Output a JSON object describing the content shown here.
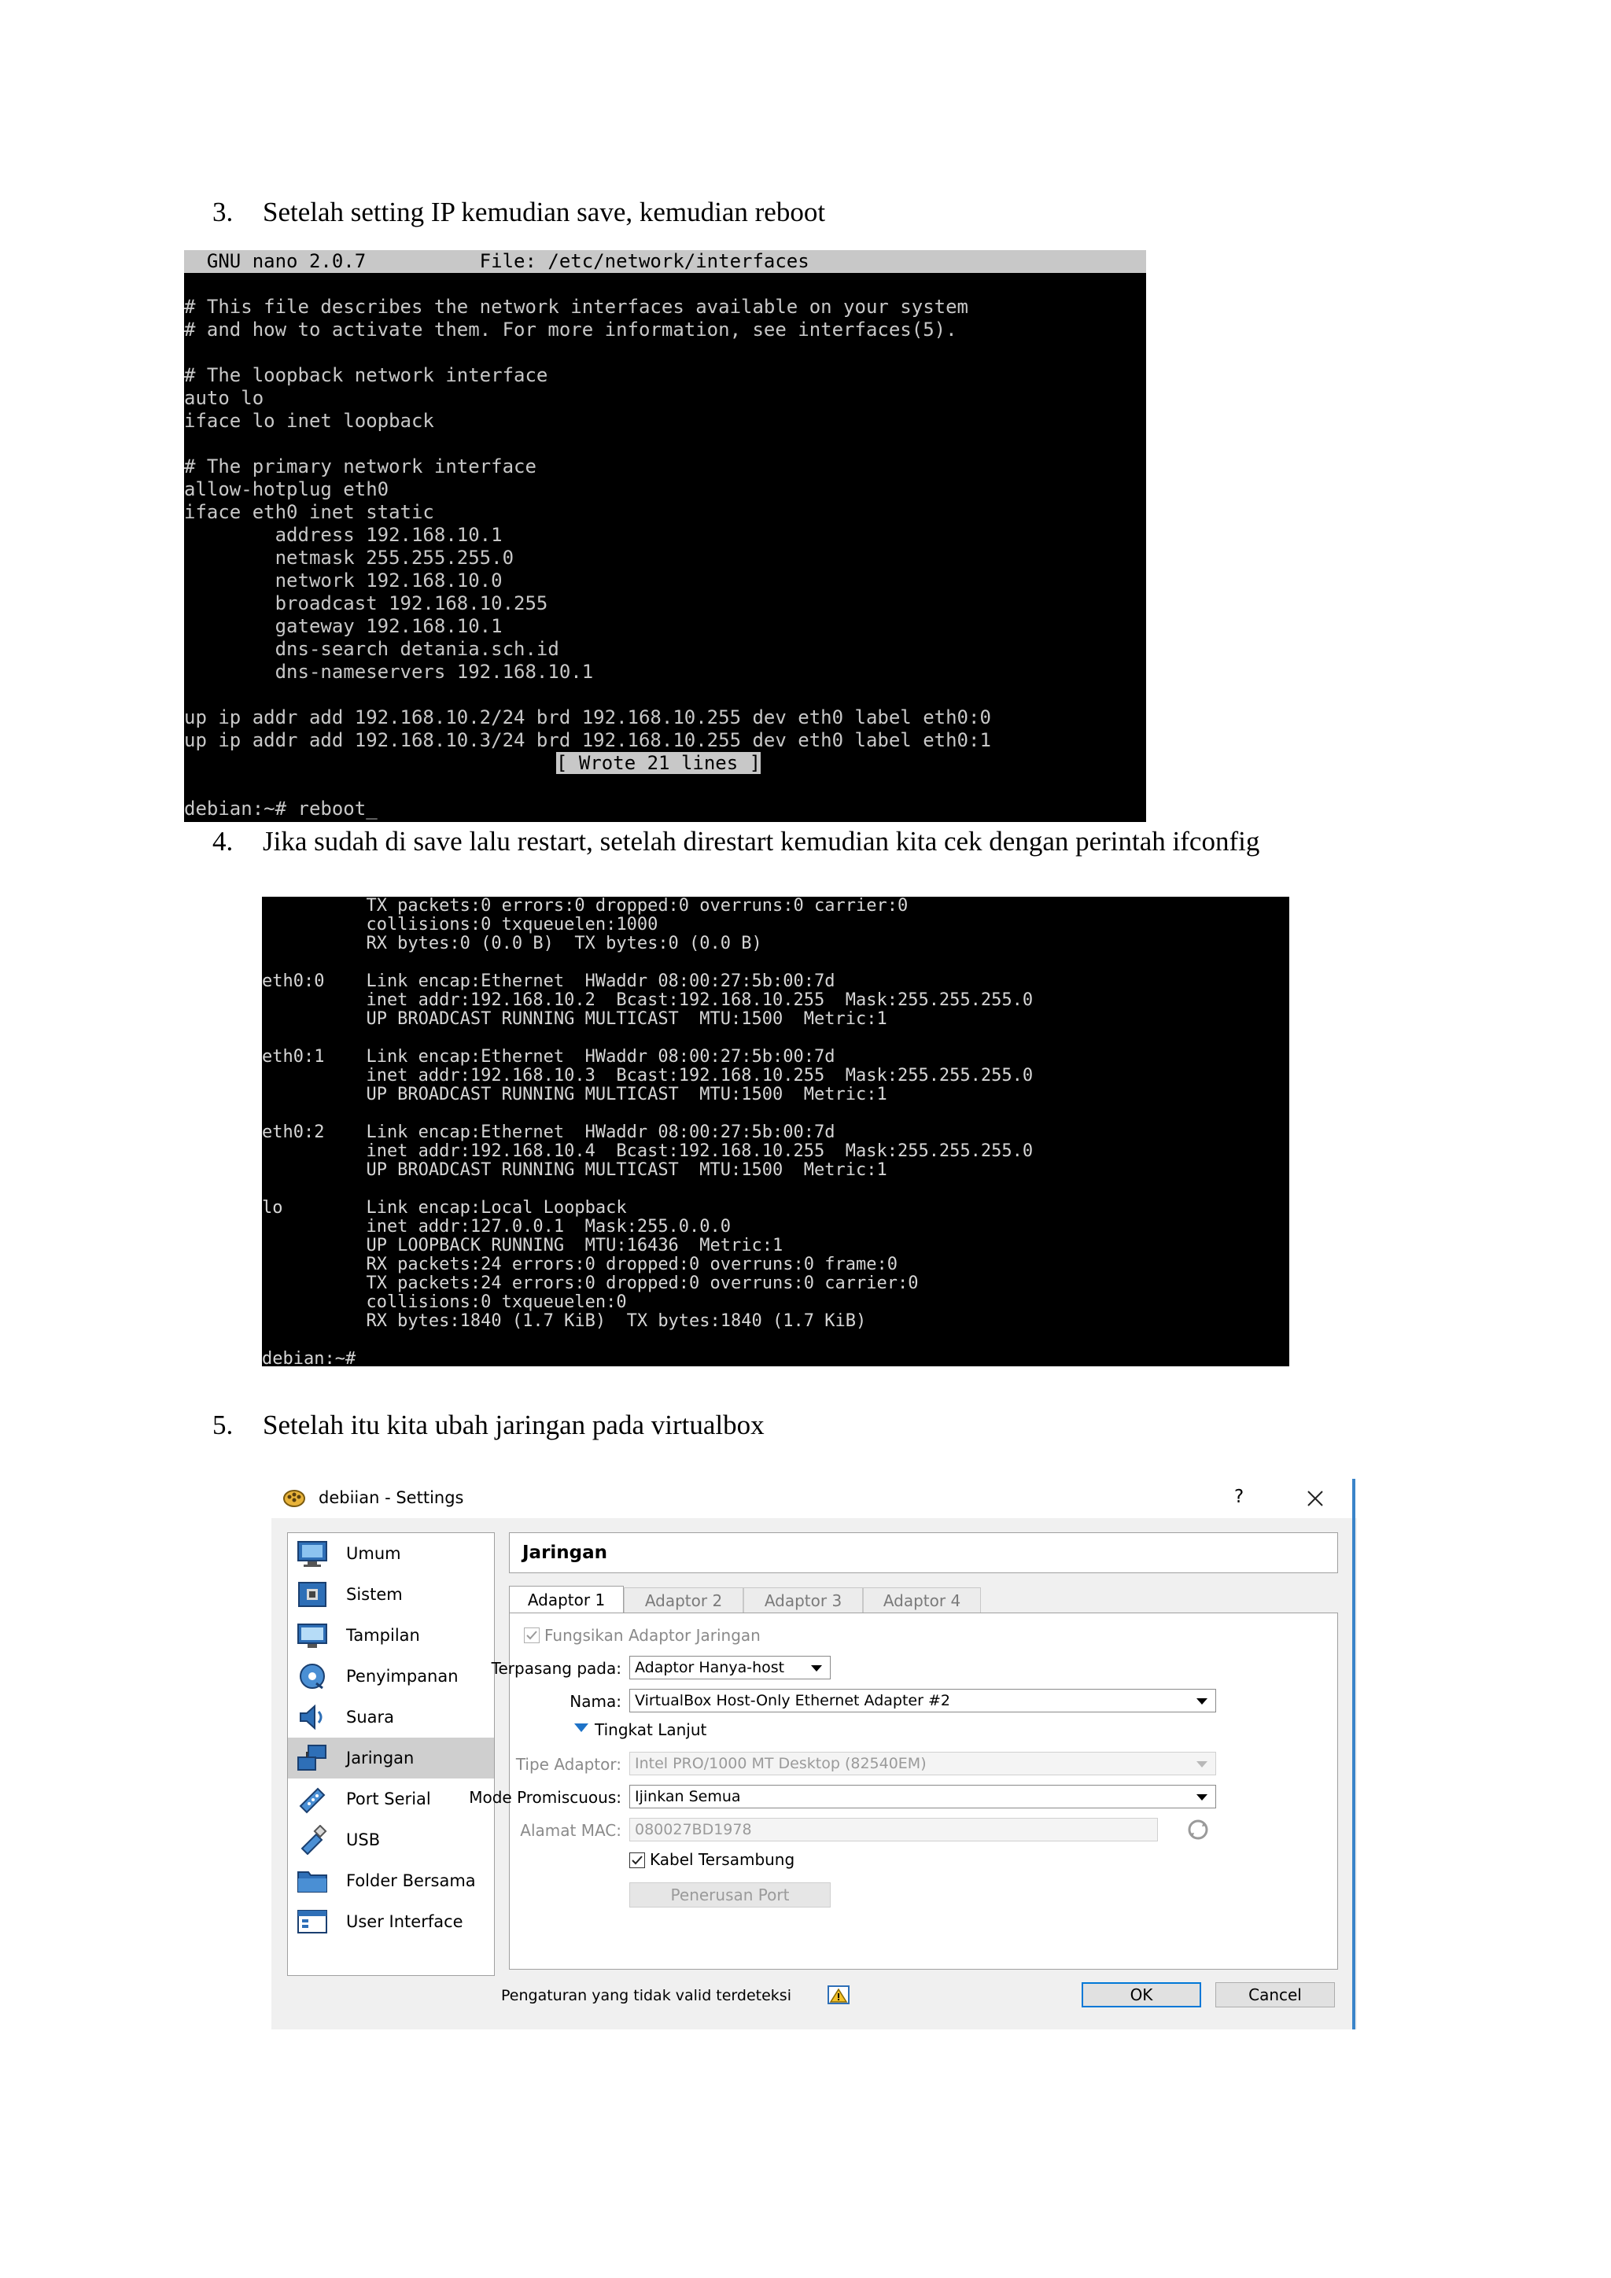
{
  "steps": [
    {
      "number": "3.",
      "text": "Setelah setting IP  kemudian save, kemudian reboot"
    },
    {
      "number": "4.",
      "text": "Jika sudah di save lalu restart, setelah direstart kemudian kita cek dengan perintah ifconfig"
    },
    {
      "number": "5.",
      "text": "Setelah itu kita ubah jaringan pada virtualbox"
    }
  ],
  "nano": {
    "header": "  GNU nano 2.0.7          File: /etc/network/interfaces",
    "lines": [
      "",
      "# This file describes the network interfaces available on your system",
      "# and how to activate them. For more information, see interfaces(5).",
      "",
      "# The loopback network interface",
      "auto lo",
      "iface lo inet loopback",
      "",
      "# The primary network interface",
      "allow-hotplug eth0",
      "iface eth0 inet static",
      "        address 192.168.10.1",
      "        netmask 255.255.255.0",
      "        network 192.168.10.0",
      "        broadcast 192.168.10.255",
      "        gateway 192.168.10.1",
      "        dns-search detania.sch.id",
      "        dns-nameservers 192.168.10.1",
      "",
      "up ip addr add 192.168.10.2/24 brd 192.168.10.255 dev eth0 label eth0:0",
      "up ip addr add 192.168.10.3/24 brd 192.168.10.255 dev eth0 label eth0:1"
    ],
    "status": "[ Wrote 21 lines ]",
    "prompt": "debian:~# reboot_"
  },
  "ifconfig": {
    "lines": [
      "          TX packets:0 errors:0 dropped:0 overruns:0 carrier:0",
      "          collisions:0 txqueuelen:1000",
      "          RX bytes:0 (0.0 B)  TX bytes:0 (0.0 B)",
      "",
      "eth0:0    Link encap:Ethernet  HWaddr 08:00:27:5b:00:7d",
      "          inet addr:192.168.10.2  Bcast:192.168.10.255  Mask:255.255.255.0",
      "          UP BROADCAST RUNNING MULTICAST  MTU:1500  Metric:1",
      "",
      "eth0:1    Link encap:Ethernet  HWaddr 08:00:27:5b:00:7d",
      "          inet addr:192.168.10.3  Bcast:192.168.10.255  Mask:255.255.255.0",
      "          UP BROADCAST RUNNING MULTICAST  MTU:1500  Metric:1",
      "",
      "eth0:2    Link encap:Ethernet  HWaddr 08:00:27:5b:00:7d",
      "          inet addr:192.168.10.4  Bcast:192.168.10.255  Mask:255.255.255.0",
      "          UP BROADCAST RUNNING MULTICAST  MTU:1500  Metric:1",
      "",
      "lo        Link encap:Local Loopback",
      "          inet addr:127.0.0.1  Mask:255.0.0.0",
      "          UP LOOPBACK RUNNING  MTU:16436  Metric:1",
      "          RX packets:24 errors:0 dropped:0 overruns:0 frame:0",
      "          TX packets:24 errors:0 dropped:0 overruns:0 carrier:0",
      "          collisions:0 txqueuelen:0",
      "          RX bytes:1840 (1.7 KiB)  TX bytes:1840 (1.7 KiB)",
      "",
      "debian:~# _"
    ]
  },
  "vbox": {
    "title": "debiian - Settings",
    "help": "?",
    "sidebar": [
      {
        "label": "Umum",
        "icon": "general-icon"
      },
      {
        "label": "Sistem",
        "icon": "system-icon"
      },
      {
        "label": "Tampilan",
        "icon": "display-icon"
      },
      {
        "label": "Penyimpanan",
        "icon": "storage-icon"
      },
      {
        "label": "Suara",
        "icon": "audio-icon"
      },
      {
        "label": "Jaringan",
        "icon": "network-icon"
      },
      {
        "label": "Port Serial",
        "icon": "serial-port-icon"
      },
      {
        "label": "USB",
        "icon": "usb-icon"
      },
      {
        "label": "Folder Bersama",
        "icon": "shared-folder-icon"
      },
      {
        "label": "User Interface",
        "icon": "user-interface-icon"
      }
    ],
    "selected": "Jaringan",
    "panel_title": "Jaringan",
    "tabs": [
      "Adaptor 1",
      "Adaptor 2",
      "Adaptor 3",
      "Adaptor 4"
    ],
    "enable_label": "Fungsikan Adaptor Jaringan",
    "attached_label": "Terpasang pada:",
    "attached_value": "Adaptor Hanya-host",
    "name_label": "Nama:",
    "name_value": "VirtualBox Host-Only Ethernet Adapter #2",
    "advanced_label": "Tingkat Lanjut",
    "adapter_type_label": "Tipe Adaptor:",
    "adapter_type_value": "Intel PRO/1000 MT Desktop (82540EM)",
    "promisc_label": "Mode Promiscuous:",
    "promisc_value": "Ijinkan Semua",
    "mac_label": "Alamat MAC:",
    "mac_value": "080027BD1978",
    "cable_label": "Kabel Tersambung",
    "port_forward_label": "Penerusan Port",
    "invalid_text": "Pengaturan yang tidak valid terdeteksi",
    "ok_label": "OK",
    "cancel_label": "Cancel",
    "accent_color": "#0078d7"
  }
}
